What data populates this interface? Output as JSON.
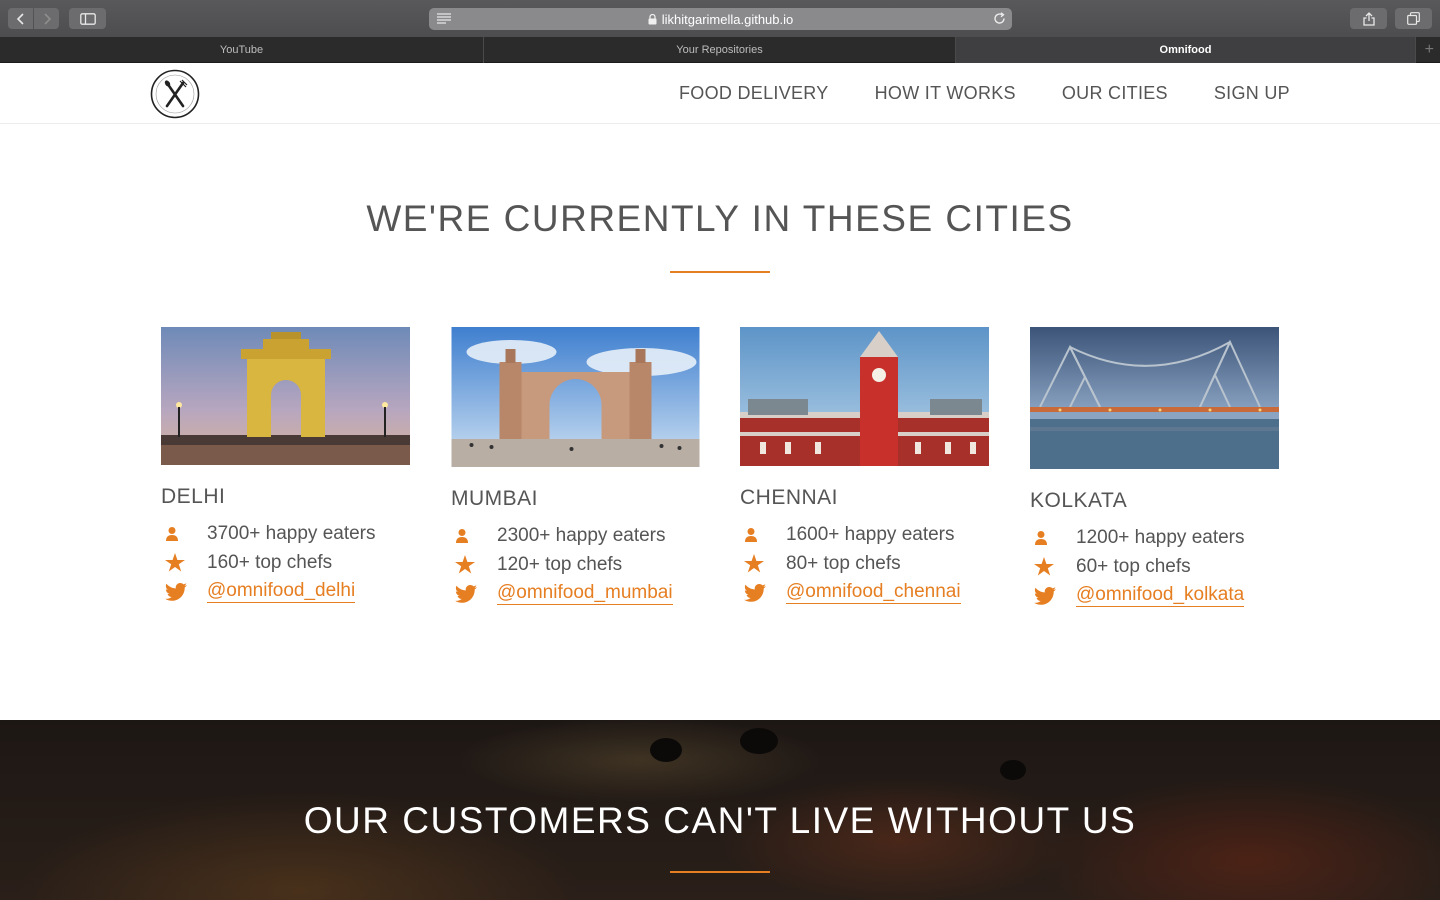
{
  "browser": {
    "url": "likhitgarimella.github.io",
    "tabs": [
      {
        "label": "YouTube",
        "active": false
      },
      {
        "label": "Your Repositories",
        "active": false
      },
      {
        "label": "Omnifood",
        "active": true
      }
    ]
  },
  "nav": {
    "logo_icon": "fork-knife-logo",
    "items": [
      "FOOD DELIVERY",
      "HOW IT WORKS",
      "OUR CITIES",
      "SIGN UP"
    ]
  },
  "cities_section": {
    "title": "WE'RE CURRENTLY IN THESE CITIES",
    "cities": [
      {
        "name": "DELHI",
        "eaters": "3700+ happy eaters",
        "chefs": "160+ top chefs",
        "twitter": "@omnifood_delhi"
      },
      {
        "name": "MUMBAI",
        "eaters": "2300+ happy eaters",
        "chefs": "120+ top chefs",
        "twitter": "@omnifood_mumbai"
      },
      {
        "name": "CHENNAI",
        "eaters": "1600+ happy eaters",
        "chefs": "80+ top chefs",
        "twitter": "@omnifood_chennai"
      },
      {
        "name": "KOLKATA",
        "eaters": "1200+ happy eaters",
        "chefs": "60+ top chefs",
        "twitter": "@omnifood_kolkata"
      }
    ]
  },
  "testimonials_section": {
    "title": "OUR CUSTOMERS CAN'T LIVE WITHOUT US"
  },
  "colors": {
    "accent": "#e67e22",
    "text": "#555555"
  }
}
